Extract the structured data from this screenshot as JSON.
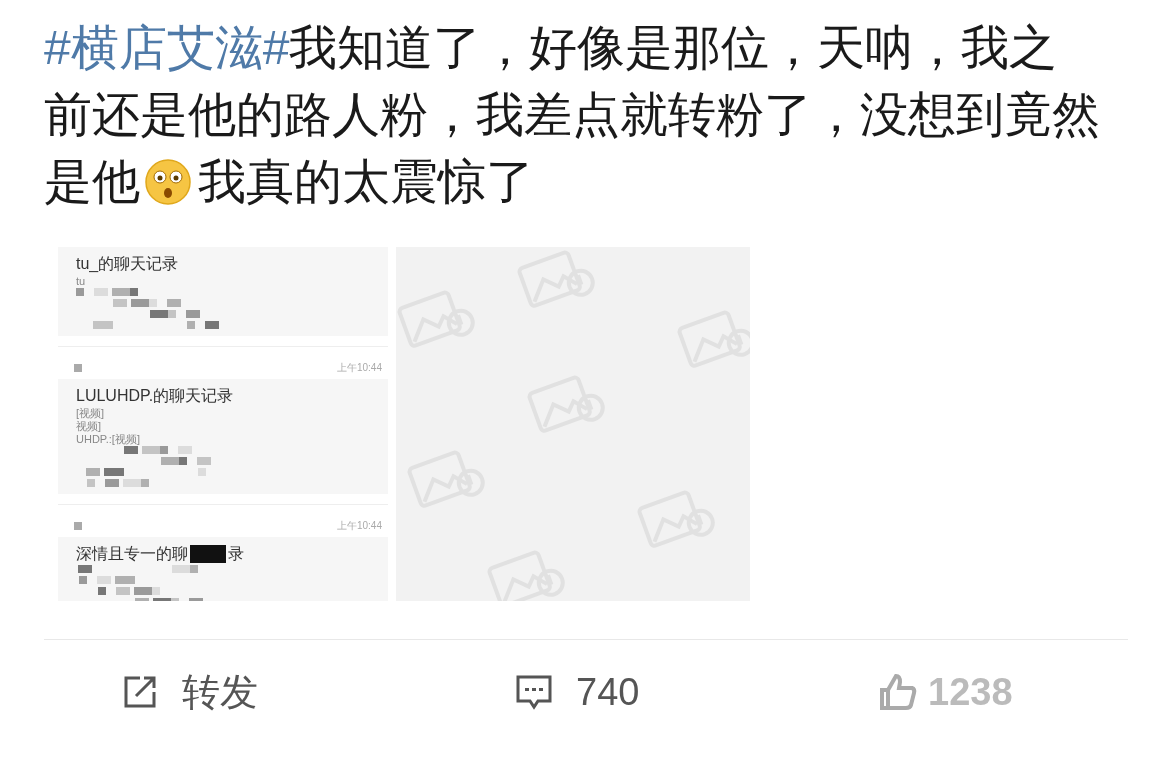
{
  "post": {
    "hashtag": "#横店艾滋#",
    "text_before_emoji": "我知道了，好像是那位，天呐，我之前还是他的路人粉，我差点就转粉了，没想到竟然是他",
    "text_after_emoji": "我真的太震惊了"
  },
  "images": [
    {
      "kind": "chat_screenshot",
      "cards": [
        {
          "title": "tu_的聊天记录",
          "lines": [
            "tu"
          ]
        },
        {
          "time": "上午10:44",
          "title": "LULUHDP.的聊天记录",
          "lines": [
            "[视频]",
            "视频]",
            "UHDP.:[视频]"
          ]
        },
        {
          "time": "上午10:44",
          "title": "深情且专一的聊",
          "title_end": "录"
        }
      ]
    },
    {
      "kind": "placeholder"
    }
  ],
  "actions": [
    {
      "kind": "repost",
      "label": "转发"
    },
    {
      "kind": "comment",
      "label": "740"
    },
    {
      "kind": "like",
      "label": "1238"
    }
  ]
}
